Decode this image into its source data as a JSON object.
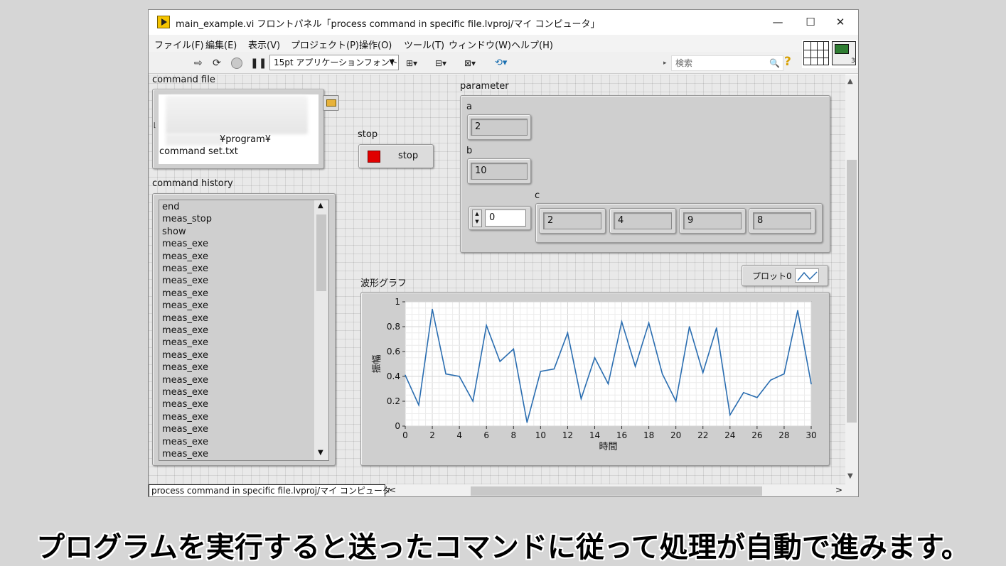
{
  "window": {
    "title": "main_example.vi フロントパネル「process command in specific file.lvproj/マイ コンピュータ」",
    "minimize": "—",
    "maximize": "☐",
    "close": "✕"
  },
  "menu": [
    "ファイル(F)",
    "編集(E)",
    "表示(V)",
    "プロジェクト(P)",
    "操作(O)",
    "ツール(T)",
    "ウィンドウ(W)",
    "ヘルプ(H)"
  ],
  "toolbar": {
    "font": "15pt アプリケーションフォント",
    "search_placeholder": "検索",
    "icon_number": "3"
  },
  "command_file": {
    "label": "command file",
    "path_line2": "¥program¥",
    "path_line3": "command set.txt"
  },
  "stop": {
    "label": "stop",
    "button_text": "stop"
  },
  "parameter": {
    "label": "parameter",
    "a_label": "a",
    "a_value": "2",
    "b_label": "b",
    "b_value": "10",
    "c_label": "c",
    "c_index": "0",
    "c_values": [
      "2",
      "4",
      "9",
      "8"
    ]
  },
  "command_history": {
    "label": "command history",
    "items": [
      "end",
      "meas_stop",
      "show",
      "meas_exe",
      "meas_exe",
      "meas_exe",
      "meas_exe",
      "meas_exe",
      "meas_exe",
      "meas_exe",
      "meas_exe",
      "meas_exe",
      "meas_exe",
      "meas_exe",
      "meas_exe",
      "meas_exe",
      "meas_exe",
      "meas_exe",
      "meas_exe",
      "meas_exe",
      "meas_exe"
    ]
  },
  "graph": {
    "label": "波形グラフ",
    "legend": "プロット0"
  },
  "chart_data": {
    "type": "line",
    "title": "",
    "xlabel": "時間",
    "ylabel": "振幅",
    "xlim": [
      0,
      30
    ],
    "ylim": [
      0,
      1
    ],
    "xticks": [
      "0",
      "2",
      "4",
      "6",
      "8",
      "10",
      "12",
      "14",
      "16",
      "18",
      "20",
      "22",
      "24",
      "26",
      "28",
      "30"
    ],
    "yticks": [
      "0",
      "0.2",
      "0.4",
      "0.6",
      "0.8",
      "1"
    ],
    "grid": true,
    "legend_position": "top-right",
    "series": [
      {
        "name": "プロット0",
        "color": "#2a6db0",
        "x": [
          0,
          1,
          2,
          3,
          4,
          5,
          6,
          7,
          8,
          9,
          10,
          11,
          12,
          13,
          14,
          15,
          16,
          17,
          18,
          19,
          20,
          21,
          22,
          23,
          24,
          25,
          26,
          27,
          28,
          29,
          30
        ],
        "y": [
          0.41,
          0.17,
          0.94,
          0.42,
          0.4,
          0.2,
          0.81,
          0.52,
          0.62,
          0.03,
          0.44,
          0.46,
          0.75,
          0.22,
          0.55,
          0.34,
          0.84,
          0.48,
          0.83,
          0.42,
          0.2,
          0.8,
          0.43,
          0.79,
          0.09,
          0.27,
          0.23,
          0.37,
          0.42,
          0.93,
          0.34
        ]
      }
    ]
  },
  "status": {
    "context": "process command in specific file.lvproj/マイ コンピュータ"
  },
  "caption": "プログラムを実行すると送ったコマンドに従って処理が自動で進みます。"
}
